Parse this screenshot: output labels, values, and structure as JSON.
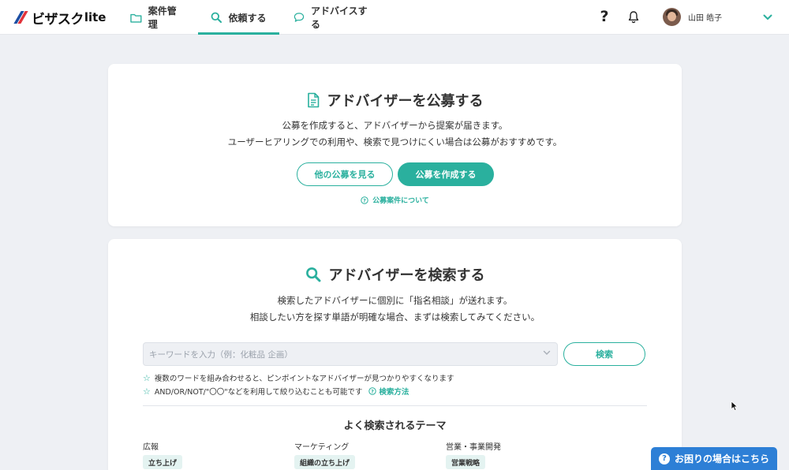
{
  "header": {
    "logo_text": "ビザスク",
    "logo_suffix": "lite",
    "nav": [
      {
        "label": "案件管理",
        "icon": "folder-icon"
      },
      {
        "label": "依頼する",
        "icon": "search-icon",
        "active": true
      },
      {
        "label": "アドバイスする",
        "icon": "chat-bubble-icon"
      }
    ],
    "help_label": "?",
    "user_name": "山田 皓子"
  },
  "publish_card": {
    "title": "アドバイザーを公募する",
    "desc_line1": "公募を作成すると、アドバイザーから提案が届きます。",
    "desc_line2": "ユーザーヒアリングでの利用や、検索で見つけにくい場合は公募がおすすめです。",
    "view_button": "他の公募を見る",
    "create_button": "公募を作成する",
    "about_link": "公募案件について"
  },
  "search_card": {
    "title": "アドバイザーを検索する",
    "desc_line1": "検索したアドバイザーに個別に「指名相談」が送れます。",
    "desc_line2": "相談したい方を探す単語が明確な場合、まずは検索してみてください。",
    "search_placeholder": "キーワードを入力（例：化粧品 企画）",
    "search_button": "検索",
    "hint1": "複数のワードを組み合わせると、ピンポイントなアドバイザーが見つかりやすくなります",
    "hint2": "AND/OR/NOT/\"〇〇\"などを利用して絞り込むことも可能です",
    "hint2_link": "検索方法",
    "theme_title": "よく検索されるテーマ",
    "categories": [
      {
        "label": "広報",
        "tag": "立ち上げ"
      },
      {
        "label": "マーケティング",
        "tag": "組織の立ち上げ"
      },
      {
        "label": "営業・事業開発",
        "tag": "営業戦略"
      }
    ]
  },
  "help_button": "お困りの場合はこちら",
  "colors": {
    "accent": "#2ab09e",
    "help_blue": "#2d7fd6",
    "background": "#eef0f4"
  }
}
